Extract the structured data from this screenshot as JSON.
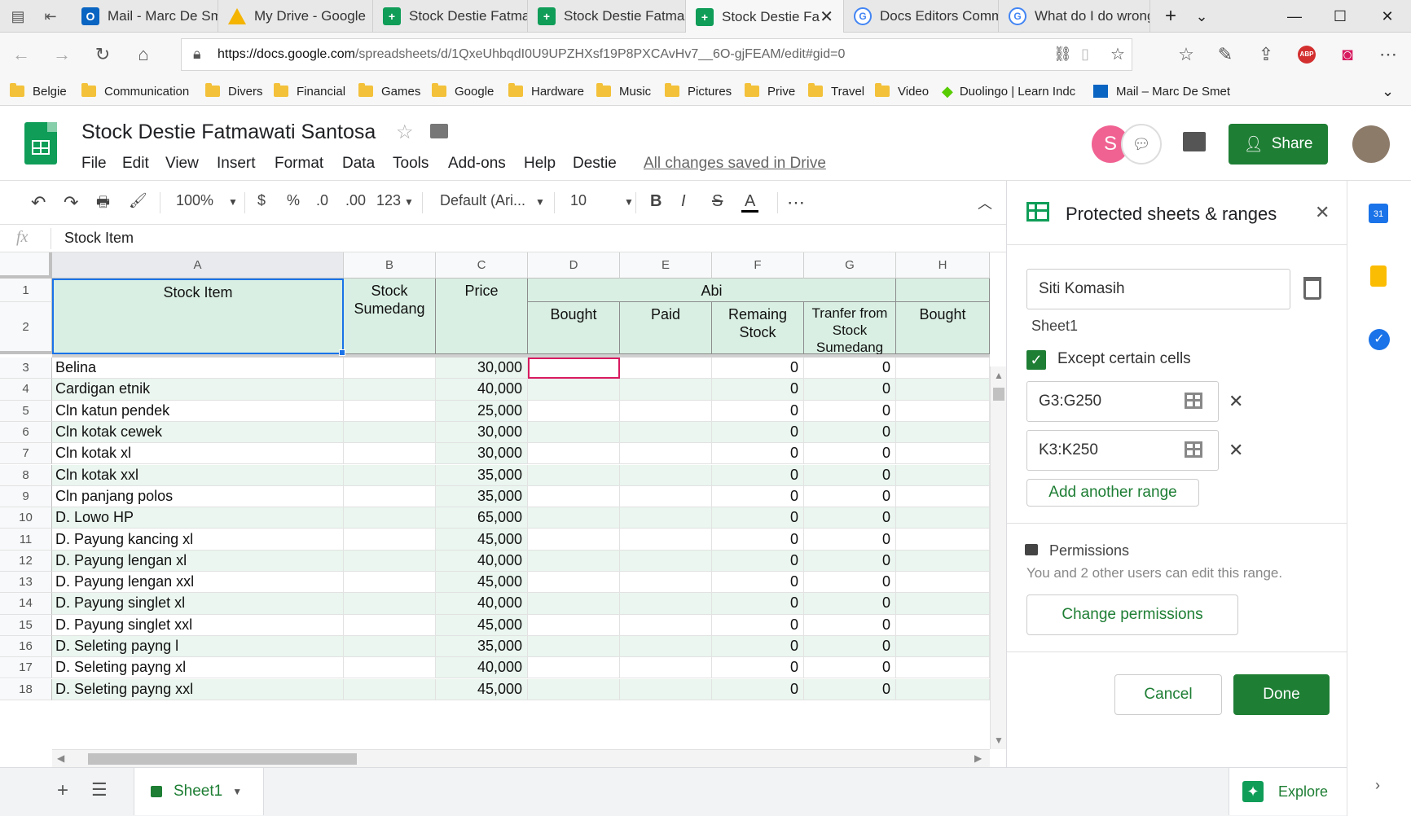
{
  "browser": {
    "tabs": [
      {
        "label": "Mail - Marc De Sme",
        "icon": "outlook-icon"
      },
      {
        "label": "My Drive - Google",
        "icon": "drive-icon"
      },
      {
        "label": "Stock Destie Fatma",
        "icon": "sheets-icon"
      },
      {
        "label": "Stock Destie Fatma",
        "icon": "sheets-icon"
      },
      {
        "label": "Stock Destie Fa",
        "icon": "sheets-icon",
        "active": true
      },
      {
        "label": "Docs Editors Comm",
        "icon": "google-icon"
      },
      {
        "label": "What do I do wrong",
        "icon": "google-icon"
      }
    ],
    "url_host": "https://docs.google.com",
    "url_path": "/spreadsheets/d/1QxeUhbqdI0U9UPZHXsf19P8PXCAvHv7__6O-gjFEAM/edit#gid=0",
    "bookmarks": [
      "Belgie",
      "Communication",
      "Divers",
      "Financial",
      "Games",
      "Google",
      "Hardware",
      "Music",
      "Pictures",
      "Prive",
      "Travel",
      "Video",
      "Duolingo | Learn Indc",
      "Mail – Marc De Smet"
    ]
  },
  "doc": {
    "title": "Stock Destie Fatmawati Santosa",
    "menus": [
      "File",
      "Edit",
      "View",
      "Insert",
      "Format",
      "Data",
      "Tools",
      "Add-ons",
      "Help",
      "Destie"
    ],
    "saved_status": "All changes saved in Drive",
    "share_label": "Share",
    "avatar_letter": "S"
  },
  "toolbar": {
    "zoom": "100%",
    "currency": "$",
    "percent": "%",
    "dec_less": ".0",
    "dec_more": ".00",
    "format_more": "123",
    "font": "Default (Ari...",
    "font_size": "10",
    "bold": "B",
    "italic": "I",
    "strike": "S",
    "text_color": "A",
    "more": "⋯"
  },
  "formula_bar": {
    "fx": "fx",
    "value": "Stock Item"
  },
  "sheet": {
    "columns": [
      "A",
      "B",
      "C",
      "D",
      "E",
      "F",
      "G",
      "H"
    ],
    "header": {
      "a": "Stock Item",
      "b": "Stock Sumedang",
      "c": "Price",
      "abi": "Abi",
      "d": "Bought",
      "e": "Paid",
      "f": "Remaing Stock",
      "g": "Tranfer from Stock Sumedang",
      "h": "Bought"
    },
    "rows": [
      {
        "n": "3",
        "item": "Belina",
        "price": "30,000",
        "f": "0",
        "g": "0"
      },
      {
        "n": "4",
        "item": "Cardigan etnik",
        "price": "40,000",
        "f": "0",
        "g": "0"
      },
      {
        "n": "5",
        "item": "Cln katun pendek",
        "price": "25,000",
        "f": "0",
        "g": "0"
      },
      {
        "n": "6",
        "item": "Cln kotak cewek",
        "price": "30,000",
        "f": "0",
        "g": "0"
      },
      {
        "n": "7",
        "item": "Cln kotak xl",
        "price": "30,000",
        "f": "0",
        "g": "0"
      },
      {
        "n": "8",
        "item": "Cln kotak xxl",
        "price": "35,000",
        "f": "0",
        "g": "0"
      },
      {
        "n": "9",
        "item": "Cln panjang polos",
        "price": "35,000",
        "f": "0",
        "g": "0"
      },
      {
        "n": "10",
        "item": "D. Lowo HP",
        "price": "65,000",
        "f": "0",
        "g": "0"
      },
      {
        "n": "11",
        "item": "D. Payung kancing xl",
        "price": "45,000",
        "f": "0",
        "g": "0"
      },
      {
        "n": "12",
        "item": "D. Payung lengan xl",
        "price": "40,000",
        "f": "0",
        "g": "0"
      },
      {
        "n": "13",
        "item": "D. Payung lengan xxl",
        "price": "45,000",
        "f": "0",
        "g": "0"
      },
      {
        "n": "14",
        "item": "D. Payung singlet xl",
        "price": "40,000",
        "f": "0",
        "g": "0"
      },
      {
        "n": "15",
        "item": "D. Payung singlet xxl",
        "price": "45,000",
        "f": "0",
        "g": "0"
      },
      {
        "n": "16",
        "item": "D. Seleting payng l",
        "price": "35,000",
        "f": "0",
        "g": "0"
      },
      {
        "n": "17",
        "item": "D. Seleting payng xl",
        "price": "40,000",
        "f": "0",
        "g": "0"
      },
      {
        "n": "18",
        "item": "D. Seleting payng xxl",
        "price": "45,000",
        "f": "0",
        "g": "0"
      }
    ],
    "tab_name": "Sheet1"
  },
  "panel": {
    "title": "Protected sheets & ranges",
    "description": "Siti Komasih",
    "scope": "Sheet1",
    "except_label": "Except certain cells",
    "except_checked": true,
    "ranges": [
      "G3:G250",
      "K3:K250"
    ],
    "add_range": "Add another range",
    "permissions_title": "Permissions",
    "permissions_text": "You and 2 other users can edit this range.",
    "change_permissions": "Change permissions",
    "cancel": "Cancel",
    "done": "Done"
  },
  "explore": {
    "label": "Explore"
  },
  "colors": {
    "accent_green": "#1e7e34",
    "header_fill": "#d9efe3",
    "band_fill": "#eaf6ef",
    "selection": "#1a73e8",
    "active_cell": "#d81b60"
  }
}
